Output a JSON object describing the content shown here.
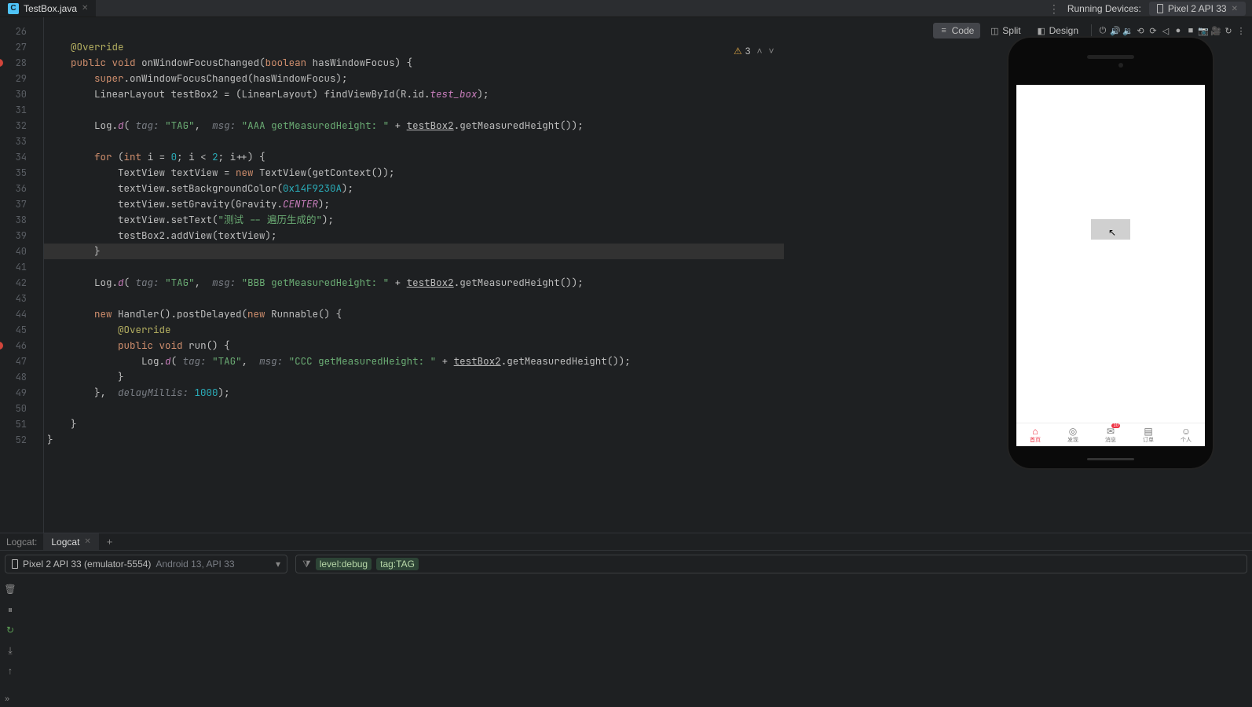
{
  "tab": {
    "filename": "TestBox.java"
  },
  "toprow": {
    "running_label": "Running Devices:",
    "device_name": "Pixel 2 API 33"
  },
  "layout_tabs": {
    "code": "Code",
    "split": "Split",
    "design": "Design"
  },
  "warnings": {
    "count": "3"
  },
  "gutter": {
    "start": 26,
    "end": 52,
    "breakpoints": [
      28,
      46
    ]
  },
  "code_lines": [
    "",
    "    @Override",
    "    public void onWindowFocusChanged(boolean hasWindowFocus) {",
    "        super.onWindowFocusChanged(hasWindowFocus);",
    "        LinearLayout testBox2 = (LinearLayout) findViewById(R.id.test_box);",
    "",
    "        Log.d( tag: \"TAG\",  msg: \"AAA getMeasuredHeight: \" + testBox2.getMeasuredHeight());",
    "",
    "        for (int i = 0; i < 2; i++) {",
    "            TextView textView = new TextView(getContext());",
    "            textView.setBackgroundColor(0x14F9230A);",
    "            textView.setGravity(Gravity.CENTER);",
    "            textView.setText(\"测试 -- 遍历生成的\");",
    "            testBox2.addView(textView);",
    "        }",
    "",
    "        Log.d( tag: \"TAG\",  msg: \"BBB getMeasuredHeight: \" + testBox2.getMeasuredHeight());",
    "",
    "        new Handler().postDelayed(new Runnable() {",
    "            @Override",
    "            public void run() {",
    "                Log.d( tag: \"TAG\",  msg: \"CCC getMeasuredHeight: \" + testBox2.getMeasuredHeight());",
    "            }",
    "        },  delayMillis: 1000);",
    "",
    "    }",
    "}",
    ""
  ],
  "phone_nav": {
    "badge": "10",
    "items": [
      "首页",
      "发现",
      "消息",
      "订单",
      "个人"
    ]
  },
  "logcat": {
    "panel_label": "Logcat:",
    "tab_label": "Logcat",
    "device": "Pixel 2 API 33 (emulator-5554)",
    "device_sub": "Android 13, API 33",
    "filter_level": "level:debug",
    "filter_tag": "tag:TAG"
  }
}
